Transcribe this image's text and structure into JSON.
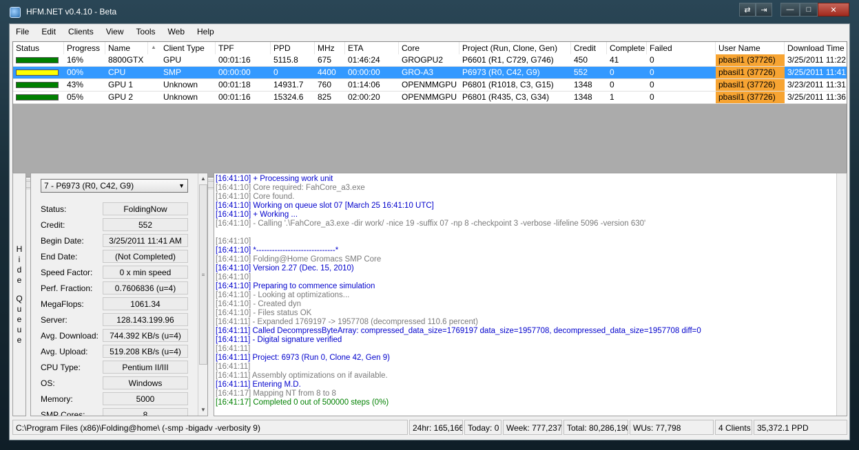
{
  "window": {
    "title": "HFM.NET v0.4.10 - Beta",
    "buttons": {
      "restore": "⇄",
      "tofront": "⇥",
      "minimize": "—",
      "maximize": "□",
      "close": "✕"
    }
  },
  "menu": [
    "File",
    "Edit",
    "Clients",
    "View",
    "Tools",
    "Web",
    "Help"
  ],
  "grid": {
    "columns": [
      "Status",
      "Progress",
      "Name",
      "Client Type",
      "TPF",
      "PPD",
      "MHz",
      "ETA",
      "Core",
      "Project (Run, Clone, Gen)",
      "Credit",
      "Complete",
      "Failed",
      "User Name",
      "Download Time"
    ],
    "sort_indicator": "▲",
    "rows": [
      {
        "status_color": "#008000",
        "progress": "16%",
        "name": "8800GTX",
        "client_type": "GPU",
        "tpf": "00:01:16",
        "ppd": "5115.8",
        "mhz": "675",
        "eta": "01:46:24",
        "core": "GROGPU2",
        "project": "P6601 (R1, C729, G746)",
        "credit": "450",
        "complete": "41",
        "failed": "0",
        "user": "pbasil1 (37726)",
        "download": "3/25/2011 11:22..."
      },
      {
        "status_color": "#ffff00",
        "progress": "00%",
        "name": "CPU",
        "client_type": "SMP",
        "tpf": "00:00:00",
        "ppd": "0",
        "mhz": "4400",
        "eta": "00:00:00",
        "core": "GRO-A3",
        "project": "P6973 (R0, C42, G9)",
        "credit": "552",
        "complete": "0",
        "failed": "0",
        "user": "pbasil1 (37726)",
        "download": "3/25/2011 11:41..."
      },
      {
        "status_color": "#008000",
        "progress": "43%",
        "name": "GPU 1",
        "client_type": "Unknown",
        "tpf": "00:01:18",
        "ppd": "14931.7",
        "mhz": "760",
        "eta": "01:14:06",
        "core": "OPENMMGPU",
        "project": "P6801 (R1018, C3, G15)",
        "credit": "1348",
        "complete": "0",
        "failed": "0",
        "user": "pbasil1 (37726)",
        "download": "3/23/2011 11:31..."
      },
      {
        "status_color": "#008000",
        "progress": "05%",
        "name": "GPU 2",
        "client_type": "Unknown",
        "tpf": "00:01:16",
        "ppd": "15324.6",
        "mhz": "825",
        "eta": "02:00:20",
        "core": "OPENMMGPU",
        "project": "P6801 (R435, C3, G34)",
        "credit": "1348",
        "complete": "1",
        "failed": "0",
        "user": "pbasil1 (37726)",
        "download": "3/25/2011 11:36..."
      }
    ]
  },
  "hide_queue": [
    "H",
    "i",
    "d",
    "e",
    "",
    "Q",
    "u",
    "e",
    "u",
    "e"
  ],
  "queue": {
    "selected": "7 - P6973 (R0, C42, G9)",
    "fields": [
      {
        "label": "Status:",
        "value": "FoldingNow"
      },
      {
        "label": "Credit:",
        "value": "552"
      },
      {
        "label": "Begin Date:",
        "value": "3/25/2011 11:41 AM"
      },
      {
        "label": "End Date:",
        "value": "(Not Completed)"
      },
      {
        "label": "Speed Factor:",
        "value": "0 x min speed"
      },
      {
        "label": "Perf. Fraction:",
        "value": "0.7606836 (u=4)"
      },
      {
        "label": "MegaFlops:",
        "value": "1061.34"
      },
      {
        "label": "Server:",
        "value": "128.143.199.96"
      },
      {
        "label": "Avg. Download:",
        "value": "744.392 KB/s (u=4)"
      },
      {
        "label": "Avg. Upload:",
        "value": "519.208 KB/s (u=4)"
      },
      {
        "label": "CPU Type:",
        "value": "Pentium II/III"
      },
      {
        "label": "OS:",
        "value": "Windows"
      },
      {
        "label": "Memory:",
        "value": "5000"
      },
      {
        "label": "SMP Cores:",
        "value": "8"
      }
    ]
  },
  "log": [
    {
      "c": "blue",
      "t": "[16:41:10] + Processing work unit"
    },
    {
      "c": "gray",
      "t": "[16:41:10] Core required: FahCore_a3.exe"
    },
    {
      "c": "gray",
      "t": "[16:41:10] Core found."
    },
    {
      "c": "blue",
      "t": "[16:41:10] Working on queue slot 07 [March 25 16:41:10 UTC]"
    },
    {
      "c": "blue",
      "t": "[16:41:10] + Working ..."
    },
    {
      "c": "gray",
      "t": "[16:41:10] - Calling '.\\FahCore_a3.exe -dir work/ -nice 19 -suffix 07 -np 8 -checkpoint 3 -verbose -lifeline 5096 -version 630'"
    },
    {
      "c": "gray",
      "t": ""
    },
    {
      "c": "gray",
      "t": "[16:41:10]"
    },
    {
      "c": "blue",
      "t": "[16:41:10] *------------------------------*"
    },
    {
      "c": "gray",
      "t": "[16:41:10] Folding@Home Gromacs SMP Core"
    },
    {
      "c": "blue",
      "t": "[16:41:10] Version 2.27 (Dec. 15, 2010)"
    },
    {
      "c": "gray",
      "t": "[16:41:10]"
    },
    {
      "c": "blue",
      "t": "[16:41:10] Preparing to commence simulation"
    },
    {
      "c": "gray",
      "t": "[16:41:10] - Looking at optimizations..."
    },
    {
      "c": "gray",
      "t": "[16:41:10] - Created dyn"
    },
    {
      "c": "gray",
      "t": "[16:41:10] - Files status OK"
    },
    {
      "c": "gray",
      "t": "[16:41:11] - Expanded 1769197 -> 1957708 (decompressed 110.6 percent)"
    },
    {
      "c": "blue",
      "t": "[16:41:11] Called DecompressByteArray: compressed_data_size=1769197 data_size=1957708, decompressed_data_size=1957708 diff=0"
    },
    {
      "c": "blue",
      "t": "[16:41:11] - Digital signature verified"
    },
    {
      "c": "gray",
      "t": "[16:41:11]"
    },
    {
      "c": "blue",
      "t": "[16:41:11] Project: 6973 (Run 0, Clone 42, Gen 9)"
    },
    {
      "c": "gray",
      "t": "[16:41:11]"
    },
    {
      "c": "gray",
      "t": "[16:41:11] Assembly optimizations on if available."
    },
    {
      "c": "blue",
      "t": "[16:41:11] Entering M.D."
    },
    {
      "c": "gray",
      "t": "[16:41:17] Mapping NT from 8 to 8"
    },
    {
      "c": "green",
      "t": "[16:41:17] Completed 0 out of 500000 steps  (0%)"
    }
  ],
  "statusbar": {
    "path": "C:\\Program Files (x86)\\Folding@home\\ (-smp -bigadv -verbosity 9)",
    "day": "24hr: 165,166",
    "today": "Today: 0",
    "week": "Week: 777,237",
    "total": "Total: 80,286,190",
    "wus": "WUs: 77,798",
    "clients": "4 Clients",
    "ppd": "35,372.1 PPD"
  },
  "colors": {
    "selected_row": "#3399ff",
    "user_highlight": "#f7a432",
    "log_blue": "#0000cc",
    "log_gray": "#7a7a7a",
    "log_green": "#008000"
  }
}
